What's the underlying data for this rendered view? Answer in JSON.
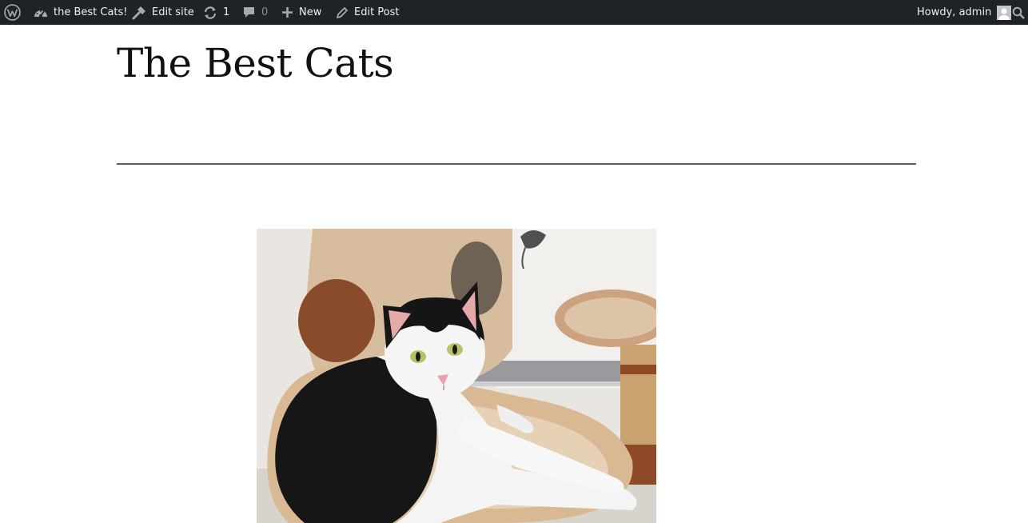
{
  "admin_bar": {
    "site_name": "the Best Cats!",
    "edit_site": "Edit site",
    "updates_count": "1",
    "comments_count": "0",
    "new_label": "New",
    "edit_post": "Edit Post",
    "greeting": "Howdy, admin",
    "icons": {
      "logo": "wordpress-logo-icon",
      "dashboard": "dashboard-gauge-icon",
      "edit_site": "hammer-icon",
      "updates": "refresh-icon",
      "comments": "speech-bubble-icon",
      "new": "plus-icon",
      "edit_post": "pencil-icon",
      "avatar": "user-avatar-icon",
      "search": "search-icon"
    }
  },
  "site": {
    "title": "The Best Cats"
  },
  "featured_image": {
    "subject": "black-and-white cat lying on a beige cat tree"
  },
  "colors": {
    "admin_bar_bg": "#1d2327",
    "admin_bar_text": "#f0f0f1",
    "muted_text": "#8c8f94",
    "title_text": "#111111",
    "separator": "#5c5c5c"
  }
}
